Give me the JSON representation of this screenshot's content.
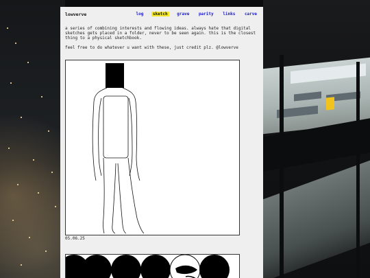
{
  "site": {
    "name": "lowverve",
    "nav": [
      {
        "label": "log",
        "active": false
      },
      {
        "label": "sketch",
        "active": true
      },
      {
        "label": "grave",
        "active": false
      },
      {
        "label": "parity",
        "active": false
      },
      {
        "label": "links",
        "active": false
      },
      {
        "label": "carve",
        "active": false
      }
    ],
    "accent": "#f6ea2a",
    "link_color": "#1919c8"
  },
  "intro": {
    "line1": "a series of combining interests and flowing ideas. always hate that digital sketches gets placed in a folder, never to be seen again. this is the closest thing to a physical sketchbook.",
    "line2": "feel free to do whatever u want with these, just credit plz. @lowverve"
  },
  "sketches": [
    {
      "date": "05.06.25",
      "subject": "standing figure with black square head"
    },
    {
      "subject": "row of black circles"
    }
  ]
}
